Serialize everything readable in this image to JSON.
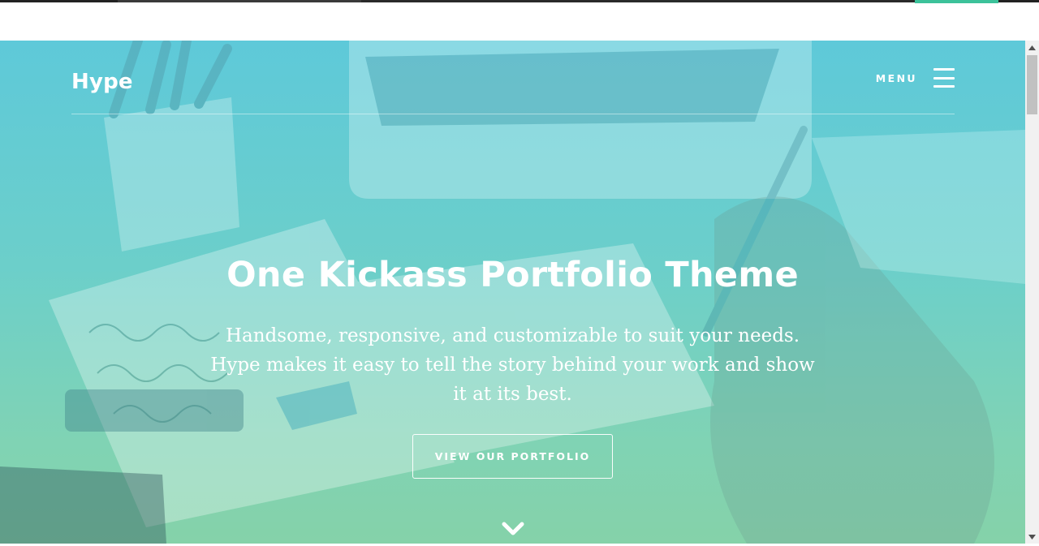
{
  "header": {
    "logo": "Hype",
    "menu_label": "MENU"
  },
  "hero": {
    "headline": "One Kickass Portfolio Theme",
    "subtext": "Handsome, responsive, and customizable to suit your needs. Hype makes it easy to tell the story behind your work and show it at its best.",
    "cta_label": "VIEW OUR PORTFOLIO"
  },
  "icons": {
    "menu": "hamburger-icon",
    "scroll_down": "chevron-down-icon"
  },
  "colors": {
    "hero_top": "#5ec9d9",
    "hero_bottom": "#85d2a9",
    "accent": "#3cc29a",
    "text": "#ffffff"
  }
}
